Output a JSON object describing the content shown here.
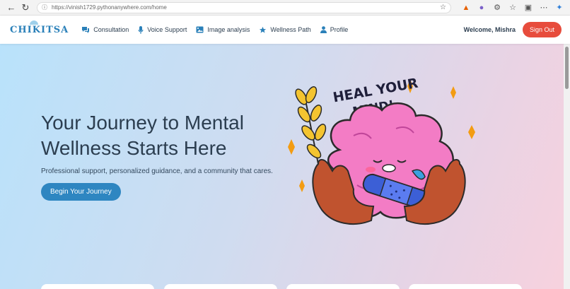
{
  "browser": {
    "url": "https://vinish1729.pythonanywhere.com/home"
  },
  "navbar": {
    "logo": "CHIKITSA",
    "items": [
      {
        "label": "Consultation",
        "icon": "chat-icon"
      },
      {
        "label": "Voice Support",
        "icon": "microphone-icon"
      },
      {
        "label": "Image analysis",
        "icon": "image-icon"
      },
      {
        "label": "Wellness Path",
        "icon": "star-icon"
      },
      {
        "label": "Profile",
        "icon": "user-icon"
      }
    ],
    "welcome": "Welcome, Mishra",
    "signout": "Sign Out"
  },
  "hero": {
    "title": "Your Journey to Mental Wellness Starts Here",
    "subtitle": "Professional support, personalized guidance, and a community that cares.",
    "cta": "Begin Your Journey",
    "illustration_text": [
      "HEAL YOUR",
      "MIND!"
    ]
  },
  "colors": {
    "brand": "#2a80b9",
    "signout": "#e74c3c",
    "cta": "#2e86c1",
    "heading": "#2c3e50"
  }
}
